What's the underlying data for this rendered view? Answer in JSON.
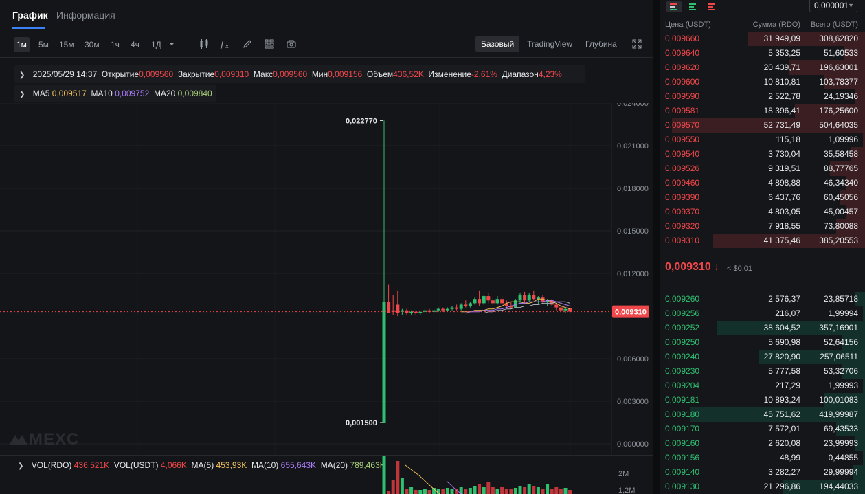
{
  "tabs": {
    "chart": "График",
    "info": "Информация"
  },
  "toolbar": {
    "timeframes": [
      "1м",
      "5м",
      "15м",
      "30м",
      "1ч",
      "4ч",
      "1Д"
    ],
    "active_timeframe": "1м",
    "views": [
      "Базовый",
      "TradingView",
      "Глубина"
    ],
    "active_view": "Базовый"
  },
  "ohlc": {
    "datetime": "2025/05/29 14:37",
    "open_label": "Открытие",
    "open": "0,009560",
    "close_label": "Закрытие",
    "close": "0,009310",
    "high_label": "Макс",
    "high": "0,009560",
    "low_label": "Мин",
    "low": "0,009156",
    "volume_label": "Объем",
    "volume": "436,52K",
    "change_label": "Изменение",
    "change": "-2,61%",
    "range_label": "Диапазон",
    "range": "4,23%"
  },
  "ma": {
    "ma5_label": "MA5",
    "ma5": "0,009517",
    "ma10_label": "MA10",
    "ma10": "0,009752",
    "ma20_label": "MA20",
    "ma20": "0,009840"
  },
  "chart": {
    "y_ticks": [
      "0,024000",
      "0,021000",
      "0,018000",
      "0,015000",
      "0,012000",
      "0,006000",
      "0,003000",
      "0,000000"
    ],
    "high_marker": "0,022770",
    "low_marker": "0,001500",
    "current_price_tag": "0,009310",
    "watermark": "MEXC"
  },
  "chart_data": {
    "type": "candlestick",
    "ylim": [
      0,
      0.025
    ],
    "last_price": 0.00931,
    "candles": [
      {
        "o": 0.0015,
        "h": 0.02277,
        "l": 0.0015,
        "c": 0.01
      },
      {
        "o": 0.01,
        "h": 0.0112,
        "l": 0.0093,
        "c": 0.0092
      },
      {
        "o": 0.0094,
        "h": 0.0105,
        "l": 0.0091,
        "c": 0.0093
      },
      {
        "o": 0.0098,
        "h": 0.0108,
        "l": 0.009,
        "c": 0.0092
      },
      {
        "o": 0.0093,
        "h": 0.0095,
        "l": 0.0091,
        "c": 0.0094
      },
      {
        "o": 0.0094,
        "h": 0.0095,
        "l": 0.0091,
        "c": 0.0092
      },
      {
        "o": 0.0092,
        "h": 0.0094,
        "l": 0.0091,
        "c": 0.0093
      },
      {
        "o": 0.0093,
        "h": 0.0094,
        "l": 0.0091,
        "c": 0.0092
      },
      {
        "o": 0.0092,
        "h": 0.0093,
        "l": 0.0091,
        "c": 0.0093
      },
      {
        "o": 0.0093,
        "h": 0.0095,
        "l": 0.0092,
        "c": 0.0094
      },
      {
        "o": 0.0094,
        "h": 0.0095,
        "l": 0.0092,
        "c": 0.0093
      },
      {
        "o": 0.0093,
        "h": 0.0095,
        "l": 0.0092,
        "c": 0.0094
      },
      {
        "o": 0.0094,
        "h": 0.0096,
        "l": 0.0093,
        "c": 0.0095
      },
      {
        "o": 0.0095,
        "h": 0.0096,
        "l": 0.0093,
        "c": 0.0094
      },
      {
        "o": 0.0094,
        "h": 0.0096,
        "l": 0.0093,
        "c": 0.0095
      },
      {
        "o": 0.0095,
        "h": 0.0097,
        "l": 0.0094,
        "c": 0.0096
      },
      {
        "o": 0.0096,
        "h": 0.0098,
        "l": 0.0094,
        "c": 0.0095
      },
      {
        "o": 0.0095,
        "h": 0.0099,
        "l": 0.0094,
        "c": 0.0098
      },
      {
        "o": 0.0098,
        "h": 0.0101,
        "l": 0.0096,
        "c": 0.0097
      },
      {
        "o": 0.0097,
        "h": 0.01,
        "l": 0.0096,
        "c": 0.0099
      },
      {
        "o": 0.0099,
        "h": 0.0103,
        "l": 0.0098,
        "c": 0.0102
      },
      {
        "o": 0.0102,
        "h": 0.0108,
        "l": 0.0097,
        "c": 0.0099
      },
      {
        "o": 0.0099,
        "h": 0.0105,
        "l": 0.0098,
        "c": 0.0104
      },
      {
        "o": 0.0104,
        "h": 0.0106,
        "l": 0.0099,
        "c": 0.0101
      },
      {
        "o": 0.0101,
        "h": 0.0103,
        "l": 0.0098,
        "c": 0.0099
      },
      {
        "o": 0.0099,
        "h": 0.0104,
        "l": 0.0098,
        "c": 0.0102
      },
      {
        "o": 0.0102,
        "h": 0.0104,
        "l": 0.0098,
        "c": 0.0099
      },
      {
        "o": 0.0099,
        "h": 0.0101,
        "l": 0.0096,
        "c": 0.0097
      },
      {
        "o": 0.0097,
        "h": 0.01,
        "l": 0.0095,
        "c": 0.0096
      },
      {
        "o": 0.0096,
        "h": 0.0102,
        "l": 0.0096,
        "c": 0.0101
      },
      {
        "o": 0.0101,
        "h": 0.0106,
        "l": 0.0099,
        "c": 0.0105
      },
      {
        "o": 0.0105,
        "h": 0.0107,
        "l": 0.0099,
        "c": 0.0101
      },
      {
        "o": 0.0101,
        "h": 0.0106,
        "l": 0.01,
        "c": 0.0105
      },
      {
        "o": 0.0105,
        "h": 0.0108,
        "l": 0.0101,
        "c": 0.0102
      },
      {
        "o": 0.0102,
        "h": 0.0104,
        "l": 0.0098,
        "c": 0.0103
      },
      {
        "o": 0.0103,
        "h": 0.0105,
        "l": 0.0099,
        "c": 0.01
      },
      {
        "o": 0.01,
        "h": 0.0102,
        "l": 0.0097,
        "c": 0.0101
      },
      {
        "o": 0.0101,
        "h": 0.0102,
        "l": 0.0097,
        "c": 0.0098
      },
      {
        "o": 0.0098,
        "h": 0.0099,
        "l": 0.0094,
        "c": 0.0096
      },
      {
        "o": 0.0096,
        "h": 0.0097,
        "l": 0.0093,
        "c": 0.0094
      },
      {
        "o": 0.0094,
        "h": 0.0096,
        "l": 0.0092,
        "c": 0.0095
      },
      {
        "o": 0.00956,
        "h": 0.00956,
        "l": 0.009156,
        "c": 0.00931
      }
    ],
    "ma_lines": [
      {
        "name": "MA5",
        "color": "#f2c15c",
        "values": [
          0.0093,
          0.0093,
          0.0093,
          0.0094,
          0.0094,
          0.0094,
          0.0095,
          0.0095,
          0.0096,
          0.0097,
          0.0099,
          0.01,
          0.01,
          0.01,
          0.0099,
          0.0099,
          0.01,
          0.0102,
          0.0102,
          0.0101,
          0.01,
          0.0099,
          0.0097,
          0.0096,
          0.0095
        ]
      },
      {
        "name": "MA10",
        "color": "#a97cf8",
        "values": [
          0.0092,
          0.0093,
          0.0093,
          0.0093,
          0.0094,
          0.0094,
          0.0094,
          0.0095,
          0.0095,
          0.0096,
          0.0097,
          0.0098,
          0.0099,
          0.0099,
          0.01,
          0.01,
          0.01,
          0.01,
          0.0101,
          0.0101,
          0.01,
          0.0099,
          0.0098,
          0.0097
        ]
      },
      {
        "name": "MA20",
        "color": "#a8b0bd",
        "values": [
          0.0092,
          0.0093,
          0.0093,
          0.0094,
          0.0094,
          0.0095,
          0.0095,
          0.0096,
          0.0096,
          0.0097,
          0.0097,
          0.0098,
          0.0098,
          0.0099,
          0.0099,
          0.0099,
          0.01,
          0.01,
          0.01,
          0.0099
        ]
      }
    ]
  },
  "volume": {
    "vol_rdo_label": "VOL(RDO)",
    "vol_rdo": "436,521K",
    "vol_usdt_label": "VOL(USDT)",
    "vol_usdt": "4,066K",
    "ma5_label": "MA(5)",
    "ma5": "453,93K",
    "ma10_label": "MA(10)",
    "ma10": "655,643K",
    "ma20_label": "MA(20)",
    "ma20": "789,463K",
    "y_ticks": [
      "2M",
      "1,2M"
    ]
  },
  "orderbook": {
    "precision": "0,000001",
    "headers": {
      "price": "Цена (USDT)",
      "amount": "Сумма (RDO)",
      "total": "Всего (USDT)"
    },
    "asks": [
      {
        "price": "0,009660",
        "amount": "31 949,09",
        "total": "308,62820",
        "depth": 0.57
      },
      {
        "price": "0,009640",
        "amount": "5 353,25",
        "total": "51,60533",
        "depth": 0.1
      },
      {
        "price": "0,009620",
        "amount": "20 439,71",
        "total": "196,63001",
        "depth": 0.37
      },
      {
        "price": "0,009600",
        "amount": "10 810,81",
        "total": "103,78377",
        "depth": 0.2
      },
      {
        "price": "0,009590",
        "amount": "2 522,78",
        "total": "24,19346",
        "depth": 0.05
      },
      {
        "price": "0,009581",
        "amount": "18 396,41",
        "total": "176,25600",
        "depth": 0.34
      },
      {
        "price": "0,009570",
        "amount": "52 731,49",
        "total": "504,64035",
        "depth": 0.94
      },
      {
        "price": "0,009550",
        "amount": "115,18",
        "total": "1,09996",
        "depth": 0.01
      },
      {
        "price": "0,009540",
        "amount": "3 730,04",
        "total": "35,58458",
        "depth": 0.07
      },
      {
        "price": "0,009526",
        "amount": "9 319,51",
        "total": "88,77765",
        "depth": 0.17
      },
      {
        "price": "0,009460",
        "amount": "4 898,88",
        "total": "46,34340",
        "depth": 0.09
      },
      {
        "price": "0,009390",
        "amount": "6 437,76",
        "total": "60,45056",
        "depth": 0.12
      },
      {
        "price": "0,009370",
        "amount": "4 803,05",
        "total": "45,00457",
        "depth": 0.09
      },
      {
        "price": "0,009320",
        "amount": "7 918,55",
        "total": "73,80088",
        "depth": 0.14
      },
      {
        "price": "0,009310",
        "amount": "41 375,46",
        "total": "385,20553",
        "depth": 0.74
      }
    ],
    "last_price": "0,009310",
    "last_arrow": "↓",
    "last_usd": "< $0.01",
    "bids": [
      {
        "price": "0,009260",
        "amount": "2 576,37",
        "total": "23,85718",
        "depth": 0.05
      },
      {
        "price": "0,009256",
        "amount": "216,07",
        "total": "1,99994",
        "depth": 0.01
      },
      {
        "price": "0,009252",
        "amount": "38 604,52",
        "total": "357,16901",
        "depth": 0.72
      },
      {
        "price": "0,009250",
        "amount": "5 690,98",
        "total": "52,64156",
        "depth": 0.11
      },
      {
        "price": "0,009240",
        "amount": "27 820,90",
        "total": "257,06511",
        "depth": 0.52
      },
      {
        "price": "0,009230",
        "amount": "5 777,58",
        "total": "53,32706",
        "depth": 0.11
      },
      {
        "price": "0,009204",
        "amount": "217,29",
        "total": "1,99993",
        "depth": 0.01
      },
      {
        "price": "0,009181",
        "amount": "10 893,24",
        "total": "100,01083",
        "depth": 0.2
      },
      {
        "price": "0,009180",
        "amount": "45 751,62",
        "total": "419,99987",
        "depth": 0.85
      },
      {
        "price": "0,009170",
        "amount": "7 572,01",
        "total": "69,43533",
        "depth": 0.14
      },
      {
        "price": "0,009160",
        "amount": "2 620,08",
        "total": "23,99993",
        "depth": 0.05
      },
      {
        "price": "0,009156",
        "amount": "48,99",
        "total": "0,44855",
        "depth": 0.01
      },
      {
        "price": "0,009140",
        "amount": "3 282,27",
        "total": "29,99994",
        "depth": 0.06
      },
      {
        "price": "0,009130",
        "amount": "21 296,86",
        "total": "194,44033",
        "depth": 0.4
      }
    ]
  }
}
